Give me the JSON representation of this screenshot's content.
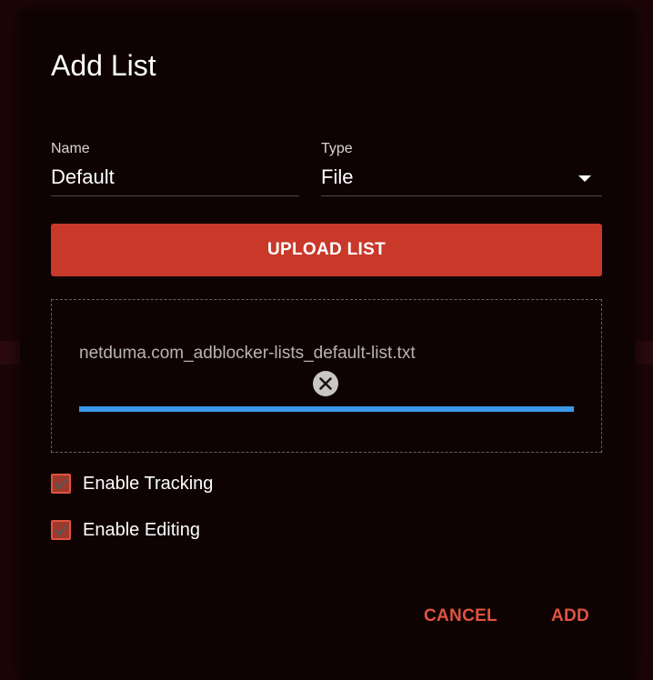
{
  "dialog": {
    "title": "Add List"
  },
  "form": {
    "name_label": "Name",
    "name_value": "Default",
    "type_label": "Type",
    "type_value": "File",
    "upload_label": "UPLOAD LIST"
  },
  "upload": {
    "file_name": "netduma.com_adblocker-lists_default-list.txt",
    "progress": 1.0
  },
  "options": [
    {
      "label": "Enable Tracking",
      "checked": true
    },
    {
      "label": "Enable Editing",
      "checked": true
    }
  ],
  "actions": {
    "cancel_label": "CANCEL",
    "add_label": "ADD"
  },
  "colors": {
    "accent": "#c8392a",
    "action_text": "#e0533f",
    "progress": "#3b97e8"
  }
}
